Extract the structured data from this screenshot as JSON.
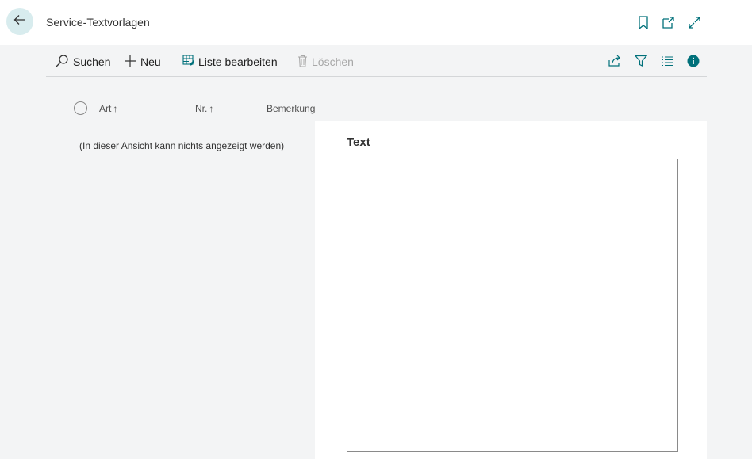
{
  "header": {
    "title": "Service-Textvorlagen",
    "icons": [
      "back-arrow-icon",
      "bookmark-icon",
      "open-new-window-icon",
      "expand-icon"
    ]
  },
  "toolbar": {
    "search_label": "Suchen",
    "new_label": "Neu",
    "edit_list_label": "Liste bearbeiten",
    "delete_label": "Löschen",
    "right_icons": [
      "share-icon",
      "filter-icon",
      "list-view-icon",
      "info-icon"
    ]
  },
  "list": {
    "columns": [
      {
        "label": "Art",
        "sort": "↑"
      },
      {
        "label": "Nr.",
        "sort": "↑"
      },
      {
        "label": "Bemerkung",
        "sort": ""
      }
    ],
    "empty_message": "(In dieser Ansicht kann nichts angezeigt werden)"
  },
  "factbox": {
    "title": "Text",
    "value": ""
  },
  "colors": {
    "accent": "#00707a",
    "back_button_bg": "#d8ecee",
    "page_bg": "#f3f4f5"
  }
}
